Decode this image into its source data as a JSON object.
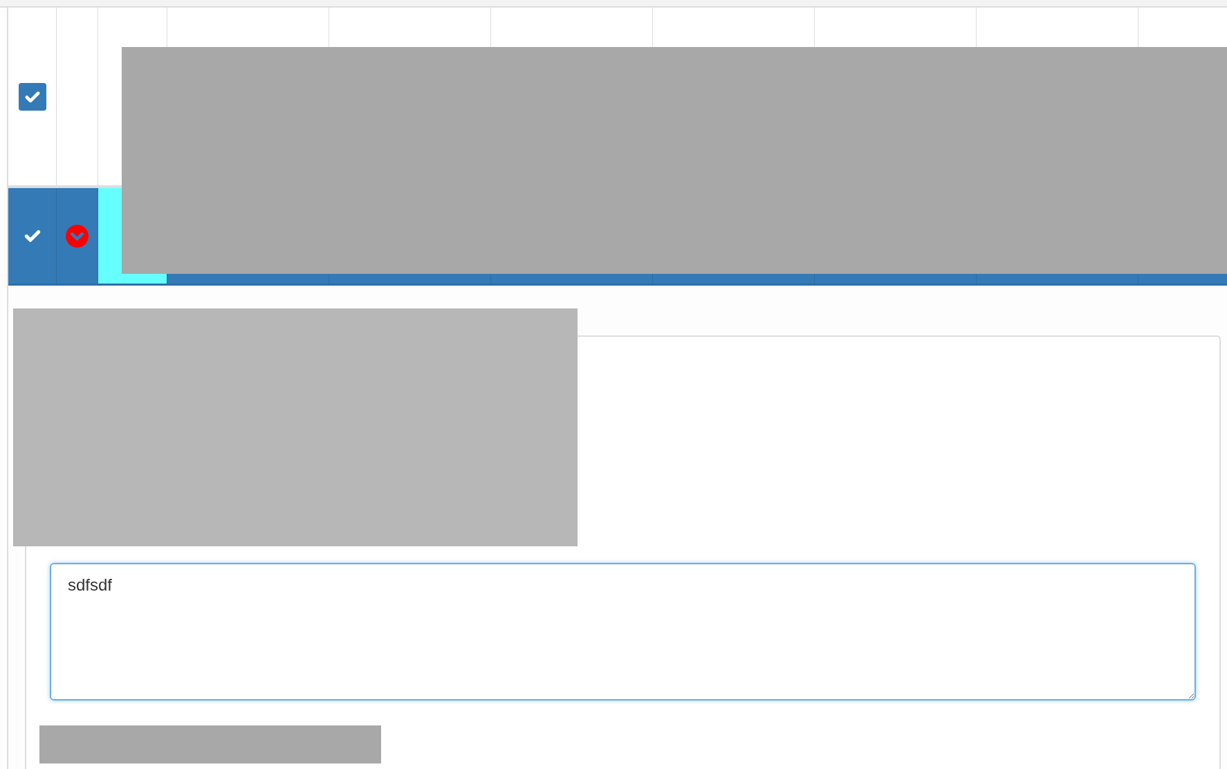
{
  "table": {
    "rows": [
      {
        "checked": true,
        "selected": false,
        "expanded": false
      },
      {
        "checked": true,
        "selected": true,
        "expanded": true
      }
    ]
  },
  "detail_panel": {
    "comment_field": {
      "value": "sdfsdf"
    }
  }
}
